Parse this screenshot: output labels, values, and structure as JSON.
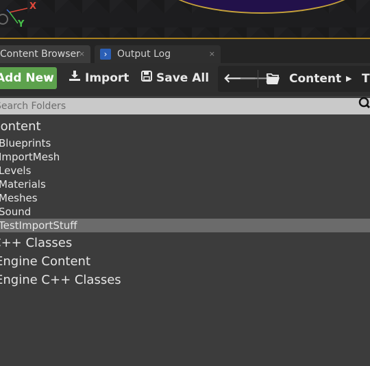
{
  "viewport": {
    "axis_x": "X",
    "axis_y": "Y"
  },
  "tabs": [
    {
      "label": "Content Browser",
      "active": true,
      "close": "×"
    },
    {
      "label": "Output Log",
      "active": false,
      "close": "×",
      "icon": "terminal-icon"
    }
  ],
  "toolbar": {
    "add_new_label": "Add New",
    "add_new_caret": "▾",
    "import_label": "Import",
    "save_all_label": "Save All",
    "back_arrow": "🡐",
    "forward_arrow": "🡒",
    "breadcrumb": [
      "Content",
      "T"
    ],
    "breadcrumb_sep": "▶",
    "accent_green": "#5da24d"
  },
  "search": {
    "placeholder": "Search Folders",
    "icon": "search-icon"
  },
  "tree": {
    "roots": [
      {
        "label": "Content"
      },
      {
        "label": "C++ Classes"
      },
      {
        "label": "Engine Content"
      },
      {
        "label": "Engine C++ Classes"
      }
    ],
    "content_children": [
      {
        "label": "Blueprints"
      },
      {
        "label": "ImportMesh"
      },
      {
        "label": "Levels"
      },
      {
        "label": "Materials"
      },
      {
        "label": "Meshes"
      },
      {
        "label": "Sound"
      },
      {
        "label": "TestImportStuff",
        "selected": true
      }
    ]
  }
}
